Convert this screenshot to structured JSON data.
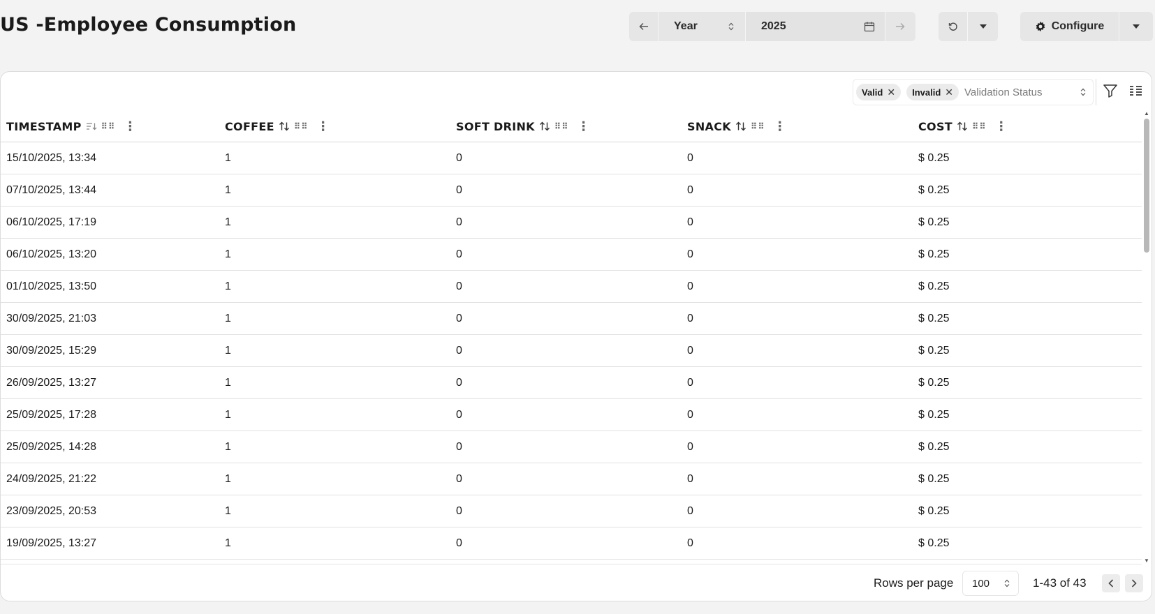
{
  "page": {
    "title": "US -Employee Consumption"
  },
  "toolbar": {
    "period_label": "Year",
    "date_value": "2025",
    "configure_label": "Configure"
  },
  "filters": {
    "chips": [
      {
        "label": "Valid"
      },
      {
        "label": "Invalid"
      }
    ],
    "placeholder": "Validation Status"
  },
  "table": {
    "columns": [
      {
        "label": "TIMESTAMP",
        "sort_icon": "sort-desc-icon"
      },
      {
        "label": "COFFEE",
        "sort_icon": "sort-icon"
      },
      {
        "label": "SOFT DRINK",
        "sort_icon": "sort-icon"
      },
      {
        "label": "SNACK",
        "sort_icon": "sort-icon"
      },
      {
        "label": "COST",
        "sort_icon": "sort-icon"
      }
    ],
    "rows": [
      [
        "15/10/2025, 13:34",
        "1",
        "0",
        "0",
        "$ 0.25"
      ],
      [
        "07/10/2025, 13:44",
        "1",
        "0",
        "0",
        "$ 0.25"
      ],
      [
        "06/10/2025, 17:19",
        "1",
        "0",
        "0",
        "$ 0.25"
      ],
      [
        "06/10/2025, 13:20",
        "1",
        "0",
        "0",
        "$ 0.25"
      ],
      [
        "01/10/2025, 13:50",
        "1",
        "0",
        "0",
        "$ 0.25"
      ],
      [
        "30/09/2025, 21:03",
        "1",
        "0",
        "0",
        "$ 0.25"
      ],
      [
        "30/09/2025, 15:29",
        "1",
        "0",
        "0",
        "$ 0.25"
      ],
      [
        "26/09/2025, 13:27",
        "1",
        "0",
        "0",
        "$ 0.25"
      ],
      [
        "25/09/2025, 17:28",
        "1",
        "0",
        "0",
        "$ 0.25"
      ],
      [
        "25/09/2025, 14:28",
        "1",
        "0",
        "0",
        "$ 0.25"
      ],
      [
        "24/09/2025, 21:22",
        "1",
        "0",
        "0",
        "$ 0.25"
      ],
      [
        "23/09/2025, 20:53",
        "1",
        "0",
        "0",
        "$ 0.25"
      ],
      [
        "19/09/2025, 13:27",
        "1",
        "0",
        "0",
        "$ 0.25"
      ]
    ]
  },
  "pagination": {
    "rows_per_page_label": "Rows per page",
    "rows_per_page_value": "100",
    "range_text": "1-43 of 43"
  }
}
